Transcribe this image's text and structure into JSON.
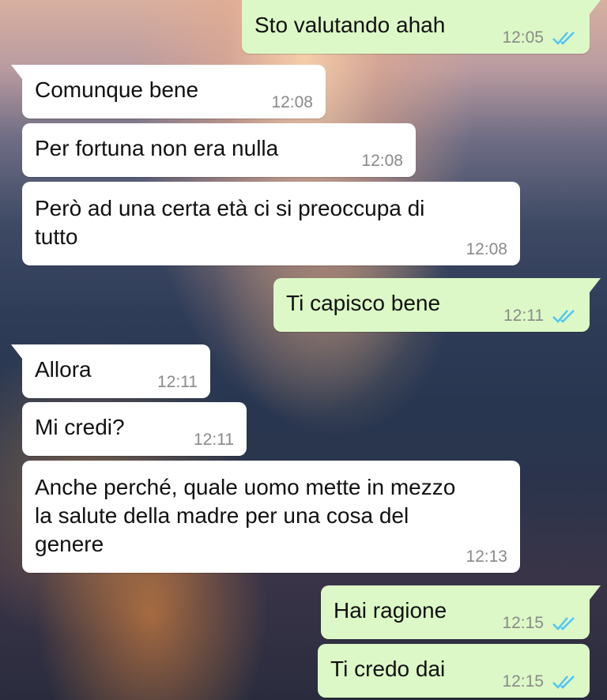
{
  "messages": [
    {
      "direction": "out",
      "text": "Sto valutando ahah",
      "time": "12:05",
      "status": "read"
    },
    {
      "direction": "in",
      "text": "Comunque bene",
      "time": "12:08"
    },
    {
      "direction": "in",
      "text": "Per fortuna non era nulla",
      "time": "12:08"
    },
    {
      "direction": "in",
      "text": "Però ad una certa età ci si preoccupa di\ntutto",
      "time": "12:08"
    },
    {
      "direction": "out",
      "text": "Ti capisco bene",
      "time": "12:11",
      "status": "read"
    },
    {
      "direction": "in",
      "text": "Allora",
      "time": "12:11"
    },
    {
      "direction": "in",
      "text": "Mi credi?",
      "time": "12:11"
    },
    {
      "direction": "in",
      "text": "Anche perché, quale uomo mette in mezzo\nla salute della madre per una cosa del\ngenere",
      "time": "12:13"
    },
    {
      "direction": "out",
      "text": "Hai ragione",
      "time": "12:15",
      "status": "read"
    },
    {
      "direction": "out",
      "text": "Ti credo dai",
      "time": "12:15",
      "status": "read"
    }
  ],
  "colors": {
    "incoming": "#ffffff",
    "outgoing": "#dcf8c6",
    "read_tick": "#4fc3f7",
    "timestamp": "#8a8a8a"
  },
  "icons": {
    "read_receipt": "double-check-icon"
  }
}
